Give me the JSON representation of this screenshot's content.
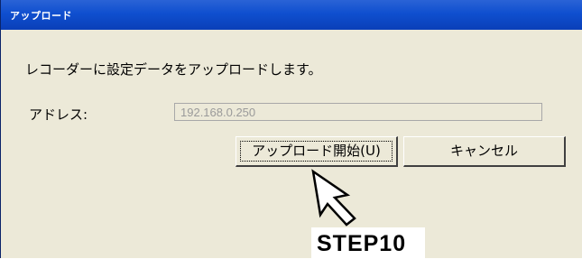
{
  "window": {
    "title": "アップロード"
  },
  "dialog": {
    "message": "レコーダーに設定データをアップロードします。",
    "address_label": "アドレス:",
    "address_value": "192.168.0.250"
  },
  "buttons": {
    "upload_label": "アップロード開始(U)",
    "cancel_label": "キャンセル"
  },
  "annotation": {
    "step_label": "STEP10",
    "pointer_icon": "arrow-pointer-icon"
  },
  "colors": {
    "titlebar": "#0f4fcf",
    "dialog_bg": "#ece9d8"
  }
}
